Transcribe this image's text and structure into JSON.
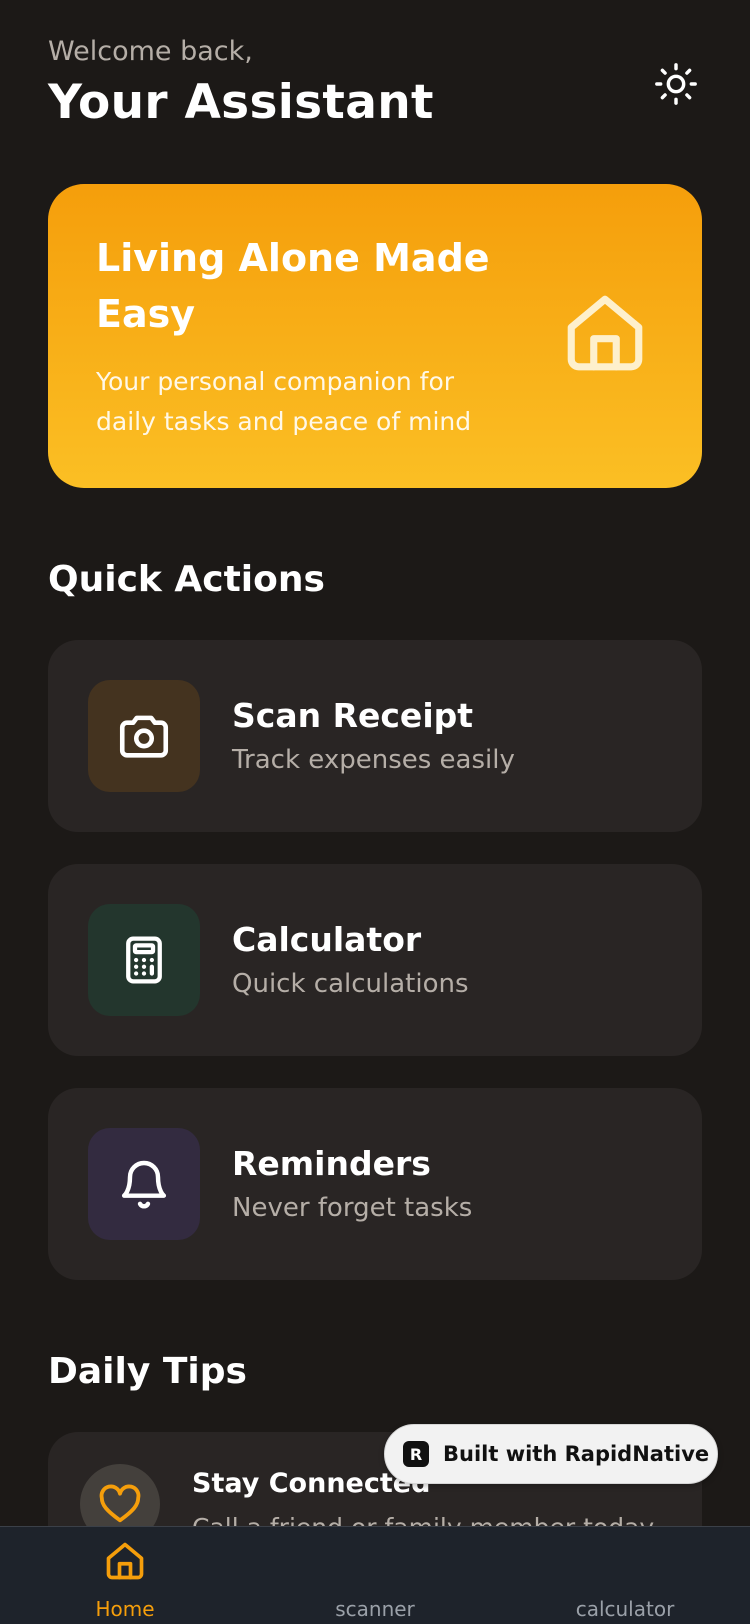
{
  "header": {
    "welcome": "Welcome back,",
    "title": "Your Assistant"
  },
  "hero": {
    "title": "Living Alone Made Easy",
    "subtitle": "Your personal companion for daily tasks and peace of mind",
    "icon": "home-icon"
  },
  "quick_actions": {
    "title": "Quick Actions",
    "items": [
      {
        "title": "Scan Receipt",
        "subtitle": "Track expenses easily",
        "icon": "camera-icon",
        "color": "#44331f"
      },
      {
        "title": "Calculator",
        "subtitle": "Quick calculations",
        "icon": "calculator-icon",
        "color": "#23362d"
      },
      {
        "title": "Reminders",
        "subtitle": "Never forget tasks",
        "icon": "bell-icon",
        "color": "#332b40"
      }
    ]
  },
  "daily_tips": {
    "title": "Daily Tips",
    "items": [
      {
        "title": "Stay Connected",
        "subtitle": "Call a friend or family member today",
        "icon": "heart-icon"
      }
    ]
  },
  "badge": {
    "text": "Built with RapidNative",
    "logo": "R"
  },
  "tabs": [
    {
      "label": "Home",
      "icon": "home-icon",
      "active": true
    },
    {
      "label": "scanner",
      "icon": "scanner-icon",
      "active": false
    },
    {
      "label": "calculator",
      "icon": "calculator-icon",
      "active": false
    }
  ],
  "colors": {
    "background": "#1c1917",
    "card": "#292524",
    "accent": "#f59e0b",
    "accent_light": "#fbbf24",
    "tabbar": "#1e232b"
  }
}
